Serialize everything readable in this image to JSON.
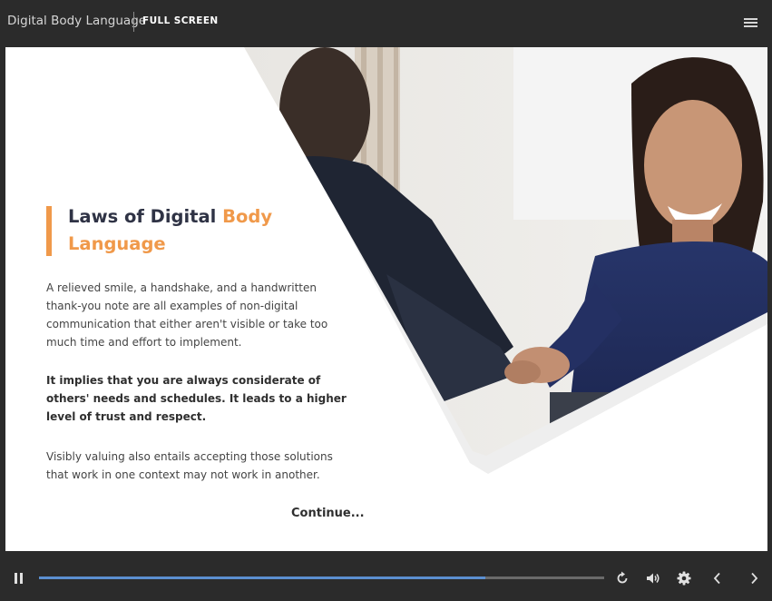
{
  "header": {
    "app_title": "Digital Body Language",
    "fullscreen_label": "FULL SCREEN"
  },
  "slide": {
    "title_part1": "Laws of Digital",
    "title_highlight": "Body Language",
    "paragraph1": "A relieved smile, a handshake, and a handwritten thank-you note are all examples of non-digital communication that either aren't visible or take too much time and effort to implement.",
    "paragraph2": "It implies that you are always considerate of others' needs and schedules. It leads to a higher level of trust and respect.",
    "paragraph3": "Visibly valuing also entails accepting those solutions that work in one context may not work in another.",
    "continue_label": "Continue..."
  },
  "player": {
    "progress": 0.79,
    "icons": [
      "pause-icon",
      "replay-icon",
      "volume-icon",
      "settings-icon",
      "previous-icon",
      "next-icon",
      "menu-icon"
    ]
  },
  "colors": {
    "accent": "#f0994a",
    "title_text": "#2f3345",
    "progress_fill": "#5b8fd0",
    "chrome_background": "#2b2b2b"
  }
}
